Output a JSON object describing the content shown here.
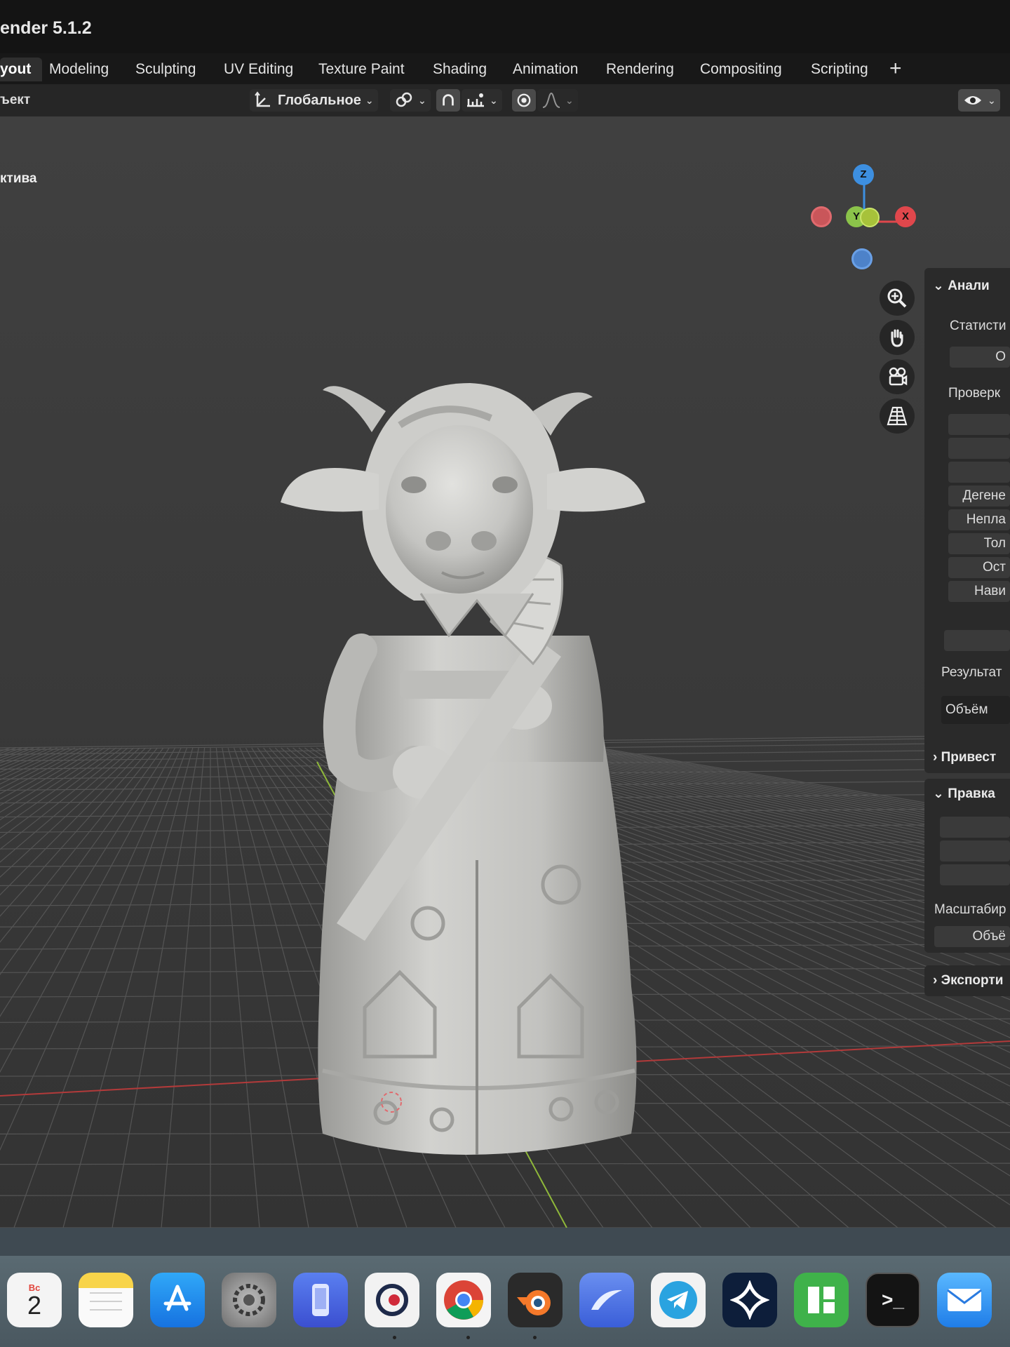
{
  "app_title": "ender 5.1.2",
  "workspaces": {
    "tabs": [
      "yout",
      "Modeling",
      "Sculpting",
      "UV Editing",
      "Texture Paint",
      "Shading",
      "Animation",
      "Rendering",
      "Compositing",
      "Scripting"
    ],
    "active": "yout",
    "add_label": "+"
  },
  "viewport_header": {
    "mode_label": "ъект",
    "transform_orientation": "Глобальное"
  },
  "viewport": {
    "overlay_text": "ктива",
    "gizmo": {
      "z": "Z",
      "y": "Y",
      "x": "X"
    }
  },
  "side_panel": {
    "analysis_header": "Анали",
    "statistics_label": "Статисти",
    "statistics_button": "О",
    "checks_label": "Проверк",
    "check_items": [
      "",
      "",
      "",
      "Дегене",
      "Непла",
      "Тол",
      "Ост",
      "Нави"
    ],
    "result_label": "Результат",
    "volume_label": "Объём",
    "cleanup_header": "Привест",
    "edit_header": "Правка",
    "scale_label": "Масштабир",
    "scale_button": "Объё",
    "export_header": "Экспорти"
  },
  "dock": {
    "calendar_day": "Вс",
    "calendar_date": "2",
    "apps": [
      "calendar",
      "notes",
      "app-store",
      "system-settings",
      "iphone-mirroring",
      "cursor",
      "chrome",
      "blender",
      "arc",
      "telegram",
      "perplexity",
      "bambu-studio",
      "terminal",
      "mail"
    ],
    "terminal_glyph": ">_"
  },
  "colors": {
    "axis_x": "#e0474c",
    "axis_y": "#8bc34a",
    "axis_z": "#3d8fe0",
    "model": "#c9c9c7",
    "viewport_bg": "#3c3c3c"
  }
}
